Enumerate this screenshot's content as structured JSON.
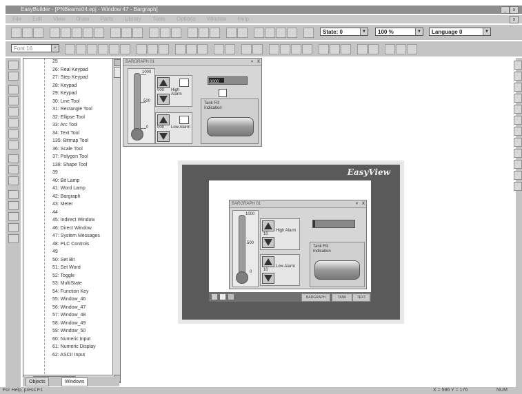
{
  "titlebar": {
    "title": "EasyBuilder - [PNBeams04.epj - Window 47 - Bargraph]",
    "min": "_",
    "max": "□",
    "close": "x"
  },
  "menubar": {
    "items": [
      "File",
      "Edit",
      "View",
      "Draw",
      "Parts",
      "Library",
      "Tools",
      "Options",
      "Window",
      "Help"
    ]
  },
  "toolbar": {
    "state_combo": "State: 0",
    "zoom_combo": "100 %",
    "language_combo": "Language 0",
    "font_combo": "Font 16"
  },
  "tree": {
    "items": [
      "25",
      "26: Real Keypad",
      "27: Step Keypad",
      "28: Keypad",
      "29: Keypad",
      "30: Line Tool",
      "31: Rectangle Tool",
      "32: Ellipse Tool",
      "33: Arc Tool",
      "34: Text Tool",
      "135: Bitmap Tool",
      "36: Scale Tool",
      "37: Polygon Tool",
      "138: Shape Tool",
      "39",
      "40: Bit Lamp",
      "41: Word Lamp",
      "42: Bargraph",
      "43: Meter",
      "44",
      "45: Indirect Window",
      "46: Direct Window",
      "47: System Messages",
      "48: PLC Controls",
      "49",
      "50: Set Bit",
      "51: Set Word",
      "52: Toggle",
      "53: MultiState",
      "54: Function Key",
      "55: Window_46",
      "56: Window_47",
      "57: Window_48",
      "58: Window_49",
      "59: Window_50",
      "60: Numeric Input",
      "61: Numeric Display",
      "62: ASCII Input"
    ]
  },
  "tabs": {
    "objects": "Objects",
    "windows": "Windows"
  },
  "canvas": {
    "popup": {
      "title": "BARGRAPH 01",
      "scale_top": "1000",
      "scale_mid": "500",
      "scale_bottom": "0",
      "high_alarm": "High Alarm",
      "low_alarm": "Low Alarm",
      "readout_a": "000",
      "readout_b": "000",
      "tank_label_1": "Tank Fill",
      "tank_label_2": "Indication",
      "level_value": "0000"
    },
    "hmi": {
      "logo": "EasyView",
      "popup_title": "BARGRAPH 01",
      "scale_top": "1000",
      "scale_mid": "500",
      "scale_bottom": "0",
      "high_alarm": "High Alarm",
      "low_alarm": "Low Alarm",
      "readout_a": "10",
      "readout_b": "10",
      "tank_label_1": "Tank Fill",
      "tank_label_2": "Indication",
      "taskbar_btn1": "BARGRAPH",
      "taskbar_btn2": "TANK",
      "taskbar_btn3": "TEXT"
    }
  },
  "statusbar": {
    "help": "For Help, press F1",
    "coords": "X = 586  Y = 176",
    "mode": "NUM"
  }
}
